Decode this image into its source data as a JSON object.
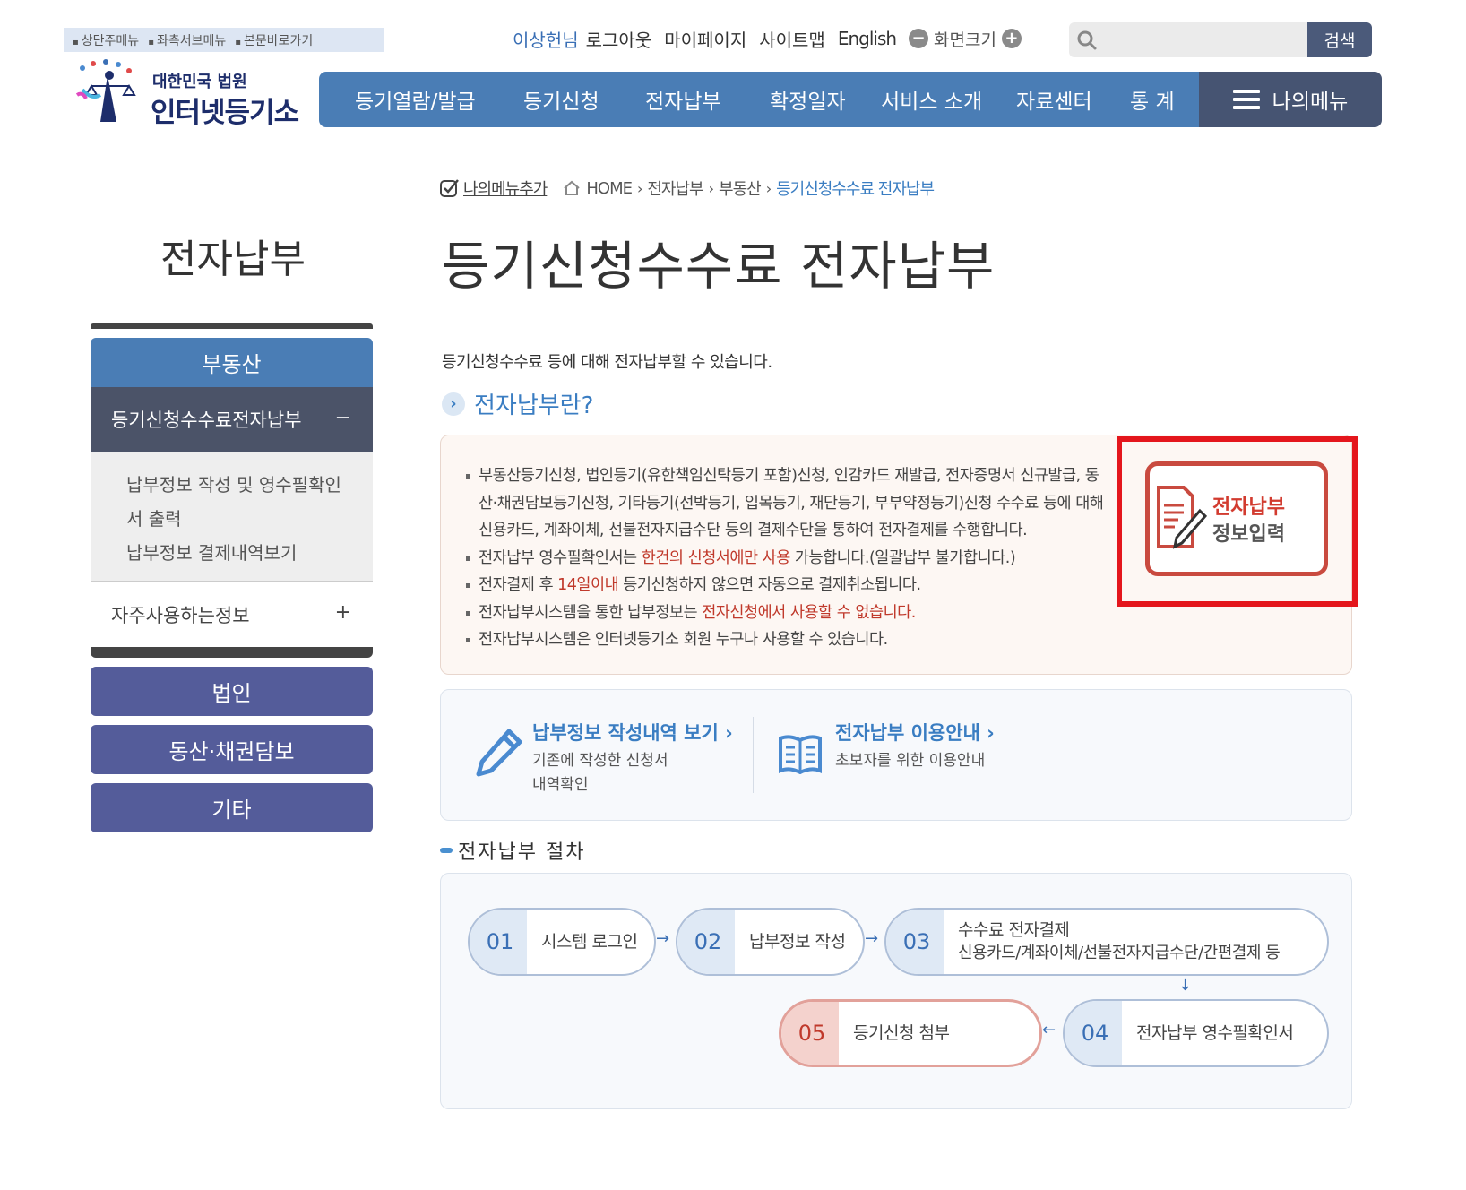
{
  "skipnav": [
    "상단주메뉴",
    "좌측서브메뉴",
    "본문바로가기"
  ],
  "util": {
    "user": "이상헌님",
    "logout": "로그아웃",
    "mypage": "마이페이지",
    "sitemap": "사이트맵",
    "english": "English",
    "zoom": "화면크기"
  },
  "search": {
    "button": "검색",
    "placeholder": ""
  },
  "logo": {
    "line1": "대한민국 법원",
    "line2": "인터넷등기소"
  },
  "gnb": [
    "등기열람/발급",
    "등기신청",
    "전자납부",
    "확정일자",
    "서비스 소개",
    "자료센터",
    "통 계"
  ],
  "mymenu": "나의메뉴",
  "breadcrumb": {
    "add": "나의메뉴추가",
    "home": "HOME",
    "c1": "전자납부",
    "c2": "부동산",
    "current": "등기신청수수료 전자납부"
  },
  "side_title": "전자납부",
  "page_title": "등기신청수수료 전자납부",
  "sidebar": {
    "head": "부동산",
    "active": "등기신청수수료전자납부",
    "active_toggle": "−",
    "sub1": "납부정보 작성 및 영수필확인서 출력",
    "sub2": "납부정보 결제내역보기",
    "often": "자주사용하는정보",
    "often_toggle": "+",
    "buttons": [
      "법인",
      "동산·채권담보",
      "기타"
    ]
  },
  "intro": "등기신청수수료 등에 대해 전자납부할 수 있습니다.",
  "section_title": "전자납부란?",
  "info": {
    "b1": "부동산등기신청, 법인등기(유한책임신탁등기 포함)신청, 인감카드 재발급, 전자증명서 신규발급, 동산·채권담보등기신청, 기타등기(선박등기, 입목등기, 재단등기, 부부약정등기)신청 수수료 등에 대해 신용카드, 계좌이체, 선불전자지급수단 등의 결제수단을 통하여 전자결제를 수행합니다.",
    "b2_a": "전자납부 영수필확인서는 ",
    "b2_red": "한건의 신청서에만 사용",
    "b2_b": " 가능합니다.(일괄납부 불가합니다.)",
    "b3_a": "전자결제 후 ",
    "b3_red": "14일이내",
    "b3_b": " 등기신청하지 않으면 자동으로 결제취소됩니다.",
    "b4_a": "전자납부시스템을 통한 납부정보는 ",
    "b4_red": "전자신청에서 사용할 수 없습니다.",
    "b5": "전자납부시스템은 인터넷등기소 회원 누구나 사용할 수 있습니다."
  },
  "epay_button": {
    "line1": "전자납부",
    "line2": "정보입력"
  },
  "links": {
    "l1_title": "납부정보 작성내역 보기 ›",
    "l1_desc": "기존에 작성한 신청서 내역확인",
    "l2_title": "전자납부 이용안내 ›",
    "l2_desc": "초보자를 위한 이용안내"
  },
  "process_title": "전자납부 절차",
  "steps": [
    {
      "num": "01",
      "label": "시스템 로그인"
    },
    {
      "num": "02",
      "label": "납부정보 작성"
    },
    {
      "num": "03",
      "label": "수수료 전자결제",
      "sub": "신용카드/계좌이체/선불전자지급수단/간편결제 등"
    },
    {
      "num": "04",
      "label": "전자납부 영수필확인서"
    },
    {
      "num": "05",
      "label": "등기신청 첨부"
    }
  ]
}
